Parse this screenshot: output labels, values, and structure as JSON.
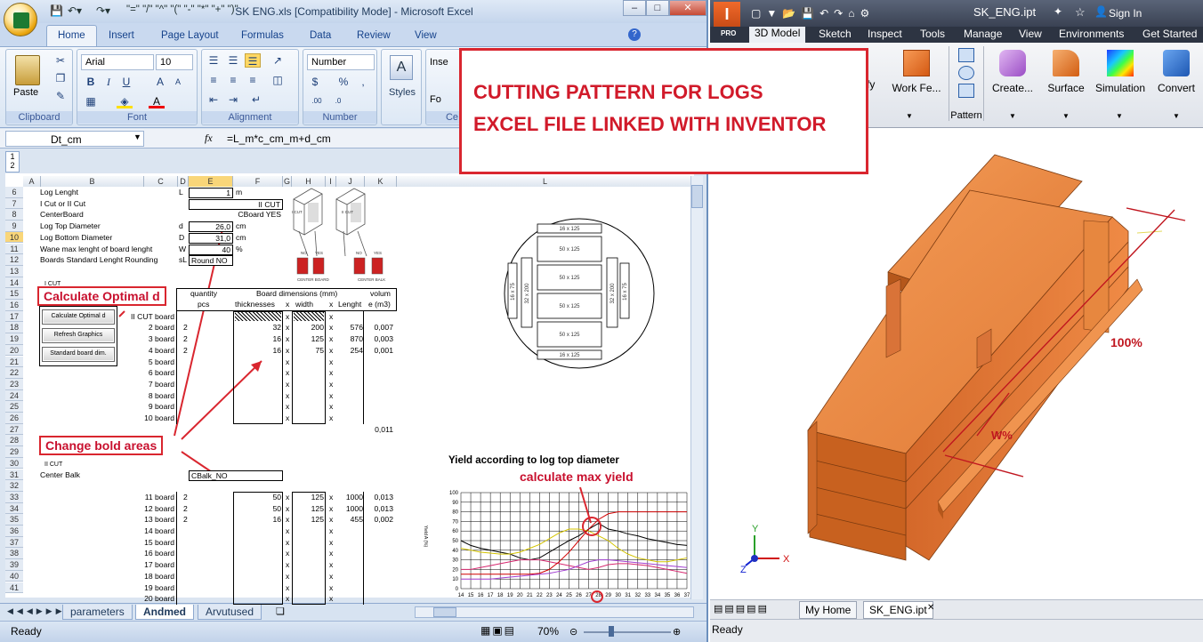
{
  "excel": {
    "title": "SK ENG.xls  [Compatibility Mode] - Microsoft Excel",
    "qat": "\"=\" \"/\" \"^\" \"(\" \"-\" \"*\" \"+\" \")\"",
    "tabs": [
      "Home",
      "Insert",
      "Page Layout",
      "Formulas",
      "Data",
      "Review",
      "View"
    ],
    "ribbon": {
      "paste": "Paste",
      "clipboard": "Clipboard",
      "font_name": "Arial",
      "font_size": "10",
      "font": "Font",
      "alignment": "Alignment",
      "number_format": "Number",
      "number": "Number",
      "styles": "Styles",
      "insert": "Inse",
      "format": "Fo",
      "cells": "Ce"
    },
    "name_box": "Dt_cm",
    "formula": "=L_m*c_cm_m+d_cm",
    "fx": "fx",
    "columns": [
      "A",
      "B",
      "C",
      "D",
      "E",
      "F",
      "G",
      "H",
      "I",
      "J",
      "K",
      "L"
    ],
    "rows": [
      "6",
      "7",
      "8",
      "9",
      "10",
      "11",
      "12",
      "13",
      "14",
      "15",
      "16",
      "17",
      "18",
      "19",
      "20",
      "21",
      "22",
      "23",
      "24",
      "25",
      "26",
      "27",
      "28",
      "29",
      "30",
      "31",
      "32",
      "33",
      "34",
      "35",
      "36",
      "37",
      "38",
      "39",
      "40",
      "41"
    ],
    "params": [
      {
        "label": "Log Lenght",
        "sym": "L",
        "val": "1",
        "unit": "m"
      },
      {
        "label": "I Cut or II Cut",
        "sym": "",
        "val": "II CUT",
        "unit": ""
      },
      {
        "label": "CenterBoard",
        "sym": "",
        "val": "CBoard YES",
        "unit": ""
      },
      {
        "label": "Log Top Diameter",
        "sym": "d",
        "val": "26,0",
        "unit": "cm"
      },
      {
        "label": "Log Bottom Diameter",
        "sym": "D",
        "val": "31,0",
        "unit": "cm"
      },
      {
        "label": "Wane max lenght of board lenght",
        "sym": "W",
        "val": "40",
        "unit": "%"
      },
      {
        "label": "Boards Standard Lenght Rounding",
        "sym": "sL",
        "val": "Round NO",
        "unit": ""
      }
    ],
    "icut": "I CUT",
    "iicut": "II CUT",
    "table_hdr": {
      "qty": "quantity",
      "pcs": "pcs",
      "dims": "Board dimensions (mm)",
      "thick": "thicknesses",
      "x": "x",
      "width": "width",
      "lenght": "Lenght",
      "vol": "volum",
      "vol2": "e (m3)"
    },
    "buttons": [
      "Calculate Optimal d",
      "Refresh Graphics",
      "Standard board dim."
    ],
    "boards1": [
      {
        "name": "II CUT board",
        "q": "",
        "t": "",
        "w": "",
        "l": "",
        "v": ""
      },
      {
        "name": "2 board",
        "q": "2",
        "t": "32",
        "w": "200",
        "l": "576",
        "v": "0,007"
      },
      {
        "name": "3 board",
        "q": "2",
        "t": "16",
        "w": "125",
        "l": "870",
        "v": "0,003"
      },
      {
        "name": "4 board",
        "q": "2",
        "t": "16",
        "w": "75",
        "l": "254",
        "v": "0,001"
      },
      {
        "name": "5 board",
        "q": "",
        "t": "",
        "w": "",
        "l": "",
        "v": ""
      },
      {
        "name": "6 board",
        "q": "",
        "t": "",
        "w": "",
        "l": "",
        "v": ""
      },
      {
        "name": "7 board",
        "q": "",
        "t": "",
        "w": "",
        "l": "",
        "v": ""
      },
      {
        "name": "8 board",
        "q": "",
        "t": "",
        "w": "",
        "l": "",
        "v": ""
      },
      {
        "name": "9 board",
        "q": "",
        "t": "",
        "w": "",
        "l": "",
        "v": ""
      },
      {
        "name": "10 board",
        "q": "",
        "t": "",
        "w": "",
        "l": "",
        "v": ""
      }
    ],
    "total1": "0,011",
    "center_balk": "Center Balk",
    "cbalk_val": "CBalk_NO",
    "boards2": [
      {
        "name": "11 board",
        "q": "2",
        "t": "50",
        "w": "125",
        "l": "1000",
        "v": "0,013"
      },
      {
        "name": "12 board",
        "q": "2",
        "t": "50",
        "w": "125",
        "l": "1000",
        "v": "0,013"
      },
      {
        "name": "13 board",
        "q": "2",
        "t": "16",
        "w": "125",
        "l": "455",
        "v": "0,002"
      },
      {
        "name": "14 board",
        "q": "",
        "t": "",
        "w": "",
        "l": "",
        "v": ""
      },
      {
        "name": "15 board",
        "q": "",
        "t": "",
        "w": "",
        "l": "",
        "v": ""
      },
      {
        "name": "16 board",
        "q": "",
        "t": "",
        "w": "",
        "l": "",
        "v": ""
      },
      {
        "name": "17 board",
        "q": "",
        "t": "",
        "w": "",
        "l": "",
        "v": ""
      },
      {
        "name": "18 board",
        "q": "",
        "t": "",
        "w": "",
        "l": "",
        "v": ""
      },
      {
        "name": "19 board",
        "q": "",
        "t": "",
        "w": "",
        "l": "",
        "v": ""
      },
      {
        "name": "20 board",
        "q": "",
        "t": "",
        "w": "",
        "l": "",
        "v": ""
      }
    ],
    "diagram_labels": [
      "I CUT",
      "II CUT",
      "NO",
      "YES",
      "NO",
      "YES",
      "CENTER BOARD",
      "CENTER BALK"
    ],
    "cross_boards": [
      "16 x 125",
      "50 x 125",
      "50 x 125",
      "50 x 125",
      "50 x 125",
      "16 x 125",
      "32 x 200",
      "16 x 75",
      "32 x 200",
      "16 x 75"
    ],
    "callouts": {
      "calc": "Calculate Optimal d",
      "change": "Change bold areas",
      "maxyield": "calculate max yield"
    },
    "chart_title": "Yield according to log top diameter",
    "chart_ylabel": "Yield A (%)",
    "sheet_tabs": [
      "parameters",
      "Andmed",
      "Arvutused"
    ],
    "status": "Ready",
    "zoom": "70%"
  },
  "chart_data": {
    "type": "line",
    "title": "Yield according to log top diameter",
    "x": [
      14,
      15,
      16,
      17,
      18,
      19,
      20,
      21,
      22,
      23,
      24,
      25,
      26,
      27,
      28,
      29,
      30,
      31,
      32,
      33,
      34,
      35,
      36,
      37
    ],
    "ylim": [
      0,
      100
    ],
    "yticks": [
      0,
      10,
      20,
      30,
      40,
      50,
      60,
      70,
      80,
      90,
      100
    ],
    "series": [
      {
        "color": "#000000",
        "values": [
          50,
          45,
          42,
          40,
          38,
          36,
          32,
          30,
          32,
          38,
          44,
          50,
          55,
          62,
          68,
          62,
          60,
          57,
          55,
          52,
          50,
          48,
          46,
          45
        ]
      },
      {
        "color": "#d4c400",
        "values": [
          42,
          40,
          38,
          37,
          36,
          36,
          38,
          42,
          46,
          52,
          58,
          62,
          62,
          60,
          55,
          50,
          42,
          36,
          32,
          30,
          28,
          28,
          30,
          32
        ]
      },
      {
        "color": "#d6286f",
        "values": [
          20,
          20,
          22,
          24,
          26,
          28,
          30,
          30,
          30,
          28,
          26,
          24,
          22,
          20,
          22,
          25,
          26,
          26,
          25,
          24,
          22,
          20,
          18,
          16
        ]
      },
      {
        "color": "#d10000",
        "values": [
          15,
          15,
          15,
          15,
          15,
          15,
          15,
          15,
          16,
          20,
          28,
          38,
          50,
          62,
          72,
          78,
          80,
          80,
          80,
          80,
          80,
          80,
          80,
          80
        ]
      },
      {
        "color": "#a23fd1",
        "values": [
          10,
          10,
          10,
          10,
          11,
          12,
          13,
          14,
          15,
          16,
          18,
          20,
          24,
          28,
          30,
          30,
          29,
          28,
          27,
          26,
          25,
          24,
          23,
          22
        ]
      }
    ]
  },
  "inventor": {
    "title": "SK_ENG.ipt",
    "signin": "Sign In",
    "pro": "PRO",
    "tabs": [
      "3D Model",
      "Sketch",
      "Inspect",
      "Tools",
      "Manage",
      "View",
      "Environments",
      "Get Started"
    ],
    "buttons": [
      "fy",
      "Work Fe...",
      "Pattern",
      "Create...",
      "Surface",
      "Simulation",
      "Convert"
    ],
    "banner": [
      "CUTTING PATTERN FOR LOGS",
      "EXCEL FILE LINKED WITH INVENTOR"
    ],
    "pct100": "100%",
    "pctW": "W%",
    "axes": {
      "x": "X",
      "y": "Y",
      "z": "Z"
    },
    "bottom_tabs": [
      "My Home",
      "SK_ENG.ipt"
    ],
    "status": "Ready"
  }
}
